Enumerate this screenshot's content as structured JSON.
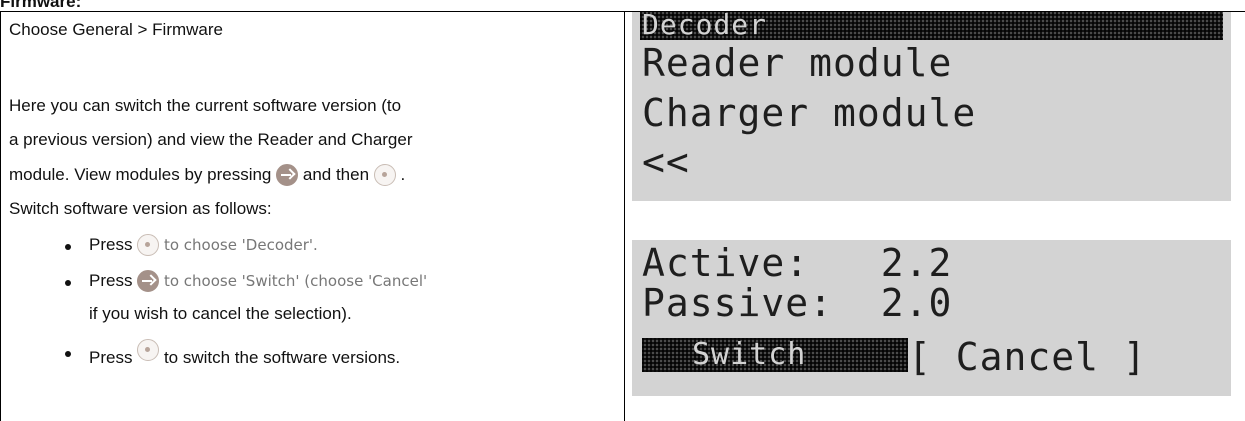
{
  "heading": "Firmware:",
  "left": {
    "line1": "Choose General > Firmware",
    "para1": "Here you can switch the current software version (to",
    "para2": "a previous version) and view the Reader and Charger",
    "para3a": "module. View modules by pressing",
    "para3b": "and then",
    "para3c": ".",
    "para4": "Switch software version as follows:",
    "bullets": [
      {
        "pre": "Press",
        "post": "to choose 'Decoder'."
      },
      {
        "pre": "Press",
        "post": "to choose 'Switch' (choose 'Cancel'"
      },
      {
        "cont": "if you wish to cancel the selection)."
      },
      {
        "pre": "Press",
        "post": "to switch the software versions."
      }
    ]
  },
  "lcd_top": {
    "header": "Decoder",
    "rows": [
      "Reader module",
      "Charger module",
      "<<"
    ]
  },
  "lcd_bottom": {
    "rows": [
      "Active:   2.2",
      "Passive:  2.0"
    ],
    "switch_label": "Switch",
    "cancel_label": "[ Cancel ]"
  },
  "icons": {
    "select": "select-center-icon",
    "arrow": "arrow-right-icon"
  }
}
